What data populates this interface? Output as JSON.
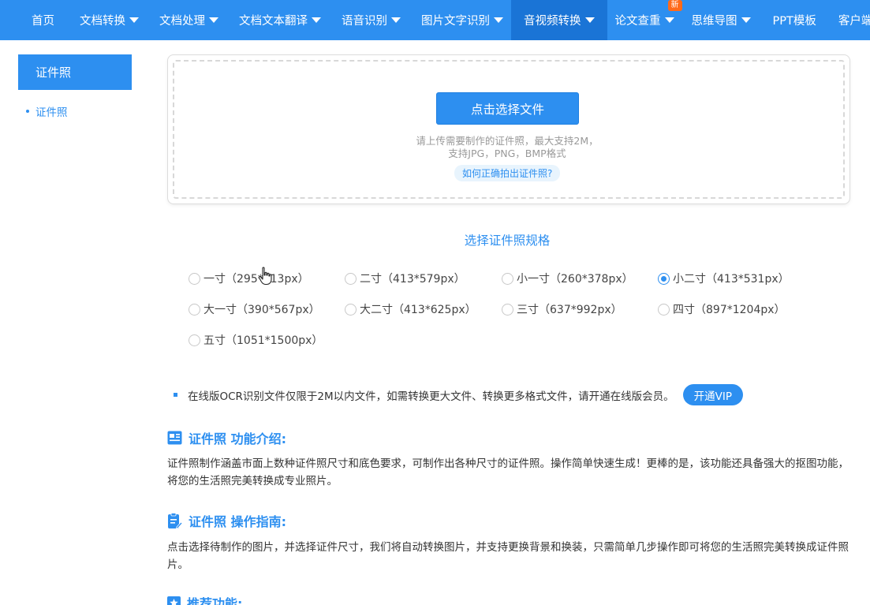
{
  "nav": {
    "items": [
      {
        "label": "首页",
        "caret": false
      },
      {
        "label": "文档转换",
        "caret": true
      },
      {
        "label": "文档处理",
        "caret": true
      },
      {
        "label": "文档文本翻译",
        "caret": true
      },
      {
        "label": "语音识别",
        "caret": true
      },
      {
        "label": "图片文字识别",
        "caret": true
      },
      {
        "label": "音视频转换",
        "caret": true
      },
      {
        "label": "论文查重",
        "caret": true,
        "badge": "新"
      },
      {
        "label": "思维导图",
        "caret": true
      },
      {
        "label": "PPT模板",
        "caret": false
      },
      {
        "label": "客户端",
        "caret": true
      }
    ]
  },
  "sidebar": {
    "title": "证件照",
    "link": "证件照"
  },
  "upload": {
    "button": "点击选择文件",
    "hint_line1": "请上传需要制作的证件照，最大支持2M，",
    "hint_line2": "支持JPG，PNG，BMP格式",
    "howto": "如何正确拍出证件照?"
  },
  "spec": {
    "title": "选择证件照规格",
    "options": [
      {
        "label": "一寸（295*413px）",
        "checked": false
      },
      {
        "label": "二寸（413*579px）",
        "checked": false
      },
      {
        "label": "小一寸（260*378px）",
        "checked": false
      },
      {
        "label": "小二寸（413*531px）",
        "checked": true
      },
      {
        "label": "大一寸（390*567px）",
        "checked": false
      },
      {
        "label": "大二寸（413*625px）",
        "checked": false
      },
      {
        "label": "三寸（637*992px）",
        "checked": false
      },
      {
        "label": "四寸（897*1204px）",
        "checked": false
      },
      {
        "label": "五寸（1051*1500px）",
        "checked": false
      }
    ]
  },
  "notice": {
    "text": "在线版OCR识别文件仅限于2M以内文件，如需转换更大文件、转换更多格式文件，请开通在线版会员。",
    "vip": "开通VIP"
  },
  "intro": {
    "title": "证件照 功能介绍:",
    "body": "证件照制作涵盖市面上数种证件照尺寸和底色要求，可制作出各种尺寸的证件照。操作简单快速生成！更棒的是，该功能还具备强大的抠图功能，将您的生活照完美转换成专业照片。"
  },
  "guide": {
    "title": "证件照 操作指南:",
    "body": "点击选择待制作的图片，并选择证件尺寸，我们将自动转换图片，并支持更换背景和换装，只需简单几步操作即可将您的生活照完美转换成证件照片。"
  },
  "recommend": {
    "title": "推荐功能:"
  },
  "colors": {
    "accent": "#2d8ff0",
    "badge": "#ff6a1a"
  }
}
